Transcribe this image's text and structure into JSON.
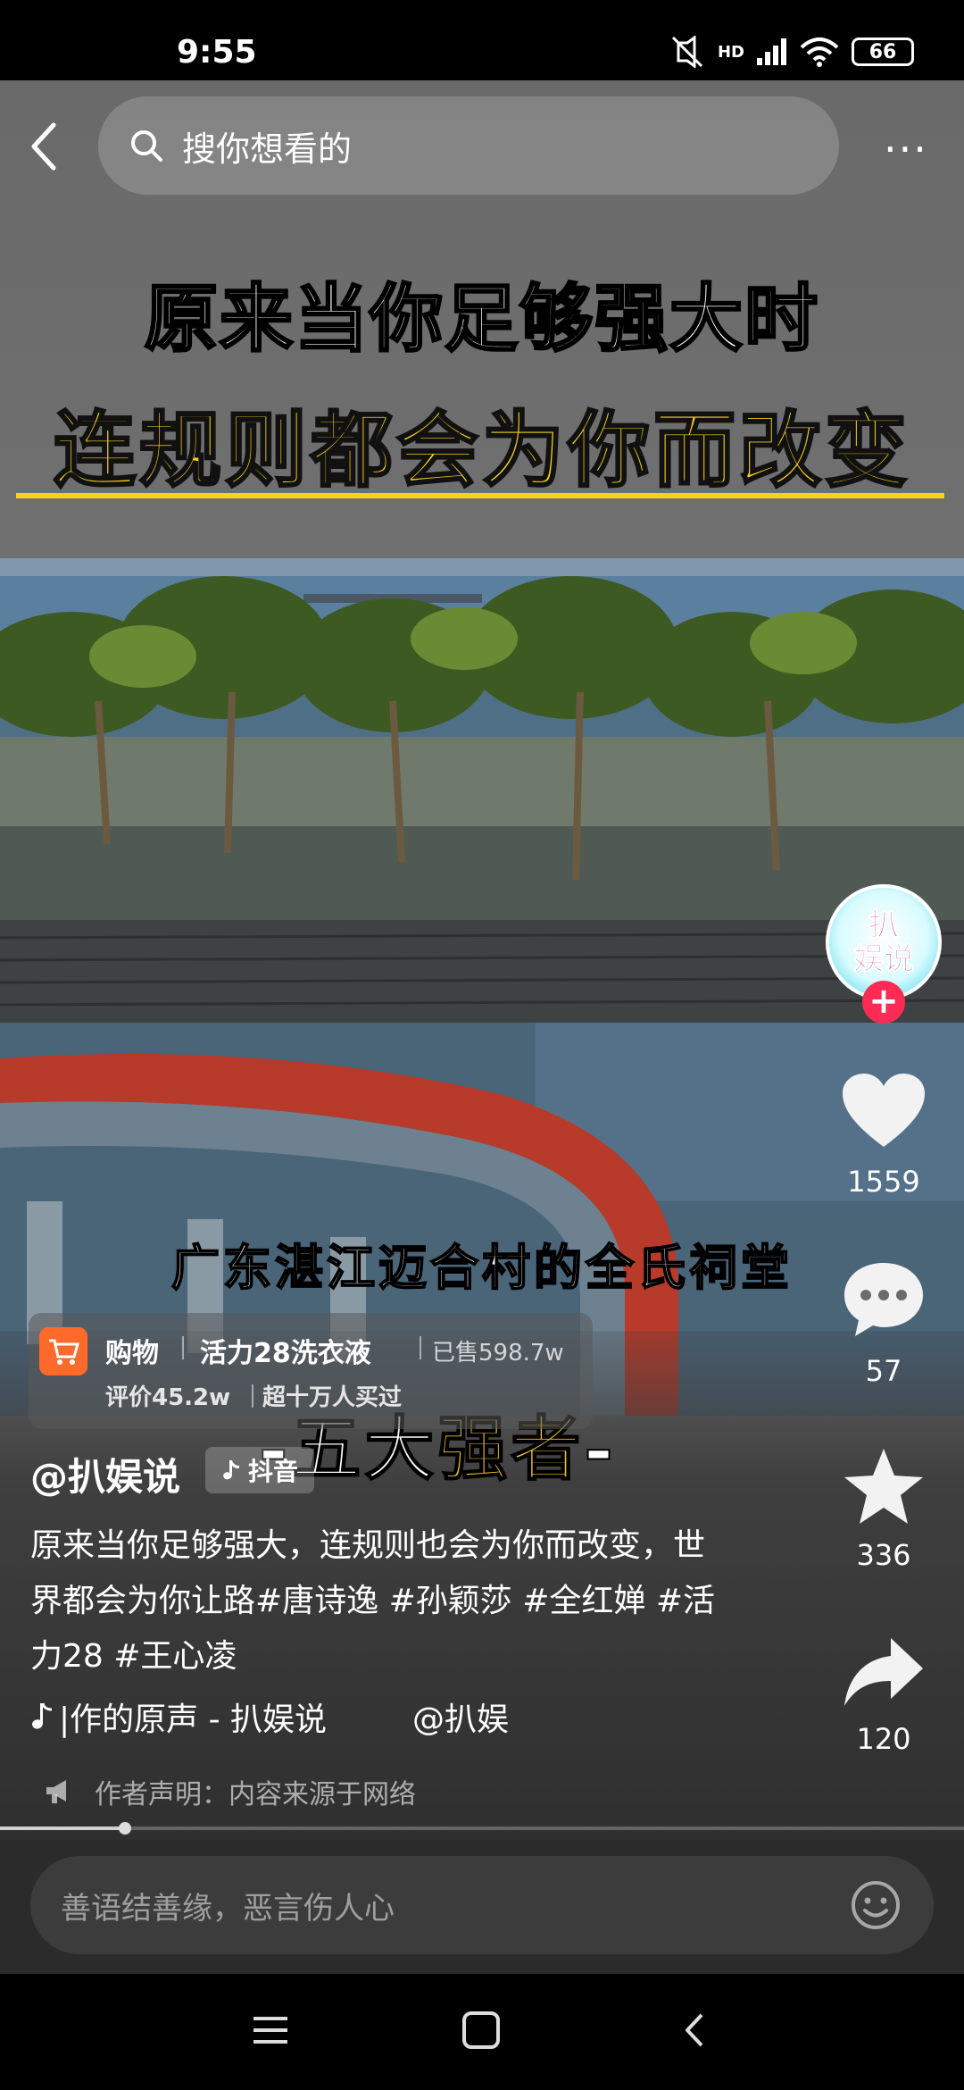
{
  "status_bar": {
    "time": "9:55",
    "network": "HD",
    "battery": "66"
  },
  "top_nav": {
    "search_placeholder": "搜你想看的"
  },
  "video": {
    "title_line1": "原来当你足够强大时",
    "title_line2": "连规则都会为你而改变",
    "caption_location": "广东湛江迈合村的全氏祠堂",
    "caption_strong_prefix": "-五大",
    "caption_strong_highlight": "强者",
    "caption_strong_suffix": "-",
    "progress": 0.13
  },
  "right_rail": {
    "avatar_text_line1": "扒",
    "avatar_text_line2": "娱说",
    "likes": "1559",
    "comments": "57",
    "favorites": "336",
    "shares": "120"
  },
  "shop_card": {
    "label": "购物",
    "product": "活力28洗衣液",
    "sold": "已售598.7w",
    "rating": "评价45.2w",
    "buyers": "超十万人买过"
  },
  "post": {
    "author": "@扒娱说",
    "platform": "抖音",
    "description": "原来当你足够强大，连规则也会为你而改变，世界都会为你让路#唐诗逸 #孙颖莎 #全红婵 #活力28 #王心凌",
    "music": "|作的原声 - 扒娱说",
    "music_mention": "@扒娱",
    "statement": "作者声明：内容来源于网络"
  },
  "comment_bar": {
    "placeholder": "善语结善缘，恶言伤人心"
  },
  "colors": {
    "accent_red": "#fe2c55",
    "caption_yellow": "#f5d21c",
    "shop_orange": "#ff6a2a"
  }
}
